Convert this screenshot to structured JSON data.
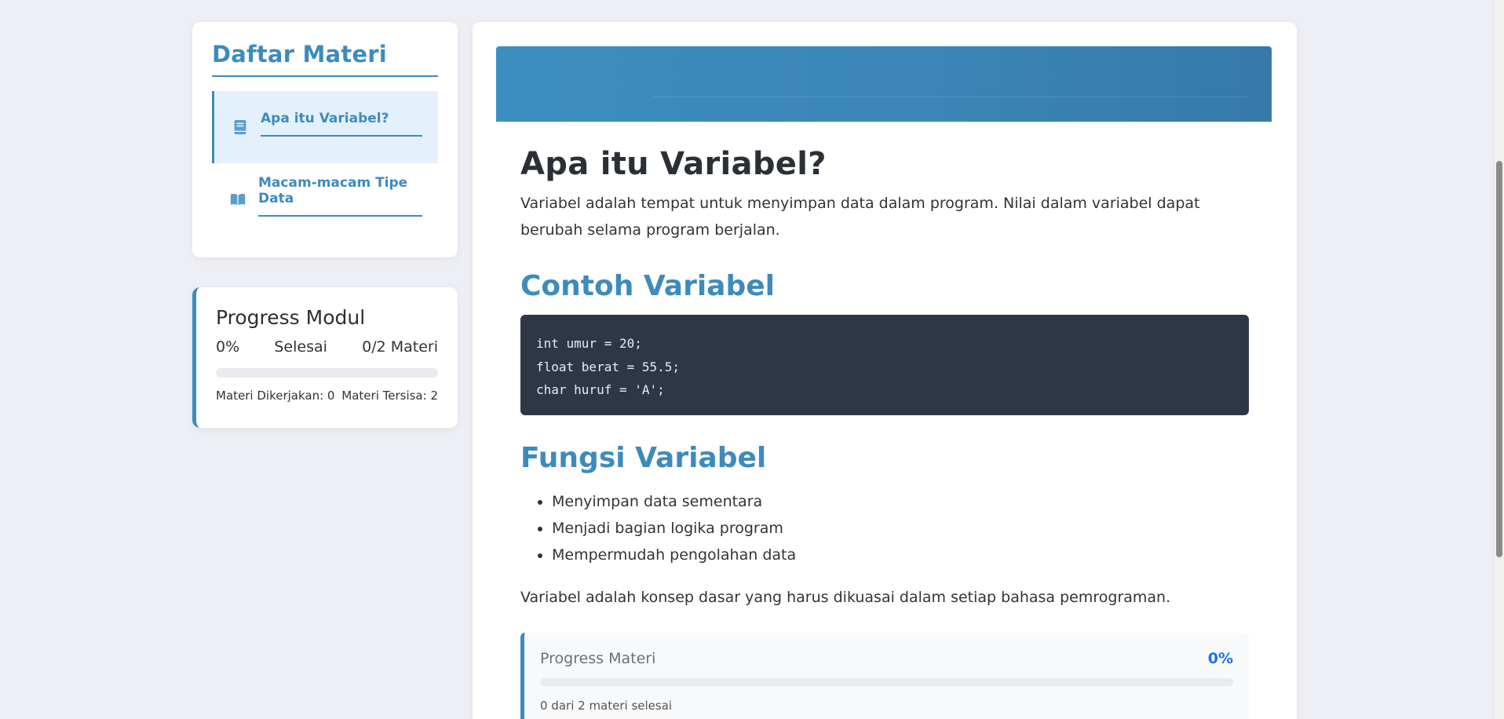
{
  "sidebar": {
    "title": "Daftar Materi",
    "items": [
      {
        "label": "Apa itu Variabel?",
        "icon": "book-icon",
        "active": true
      },
      {
        "label": "Macam-macam Tipe Data",
        "icon": "open-book-icon",
        "active": false
      }
    ]
  },
  "module_progress": {
    "title": "Progress Modul",
    "percent_label": "0%",
    "status_label": "Selesai",
    "count_label": "0/2 Materi",
    "fraction": 0,
    "done_label": "Materi Dikerjakan: 0",
    "remaining_label": "Materi Tersisa: 2"
  },
  "article": {
    "title": "Apa itu Variabel?",
    "intro": "Variabel adalah tempat untuk menyimpan data dalam program. Nilai dalam variabel dapat berubah selama program berjalan.",
    "example_heading": "Contoh Variabel",
    "code_lines": [
      "int umur = 20;",
      "float berat = 55.5;",
      "char huruf = 'A';"
    ],
    "function_heading": "Fungsi Variabel",
    "bullets": [
      "Menyimpan data sementara",
      "Menjadi bagian logika program",
      "Mempermudah pengolahan data"
    ],
    "closing": "Variabel adalah konsep dasar yang harus dikuasai dalam setiap bahasa pemrograman."
  },
  "material_progress": {
    "label": "Progress Materi",
    "percent_label": "0%",
    "fraction": 0,
    "note": "0 dari 2 materi selesai"
  },
  "colors": {
    "accent": "#3d8bbd",
    "percent_blue": "#1a73e8",
    "code_bg": "#2d3748"
  }
}
